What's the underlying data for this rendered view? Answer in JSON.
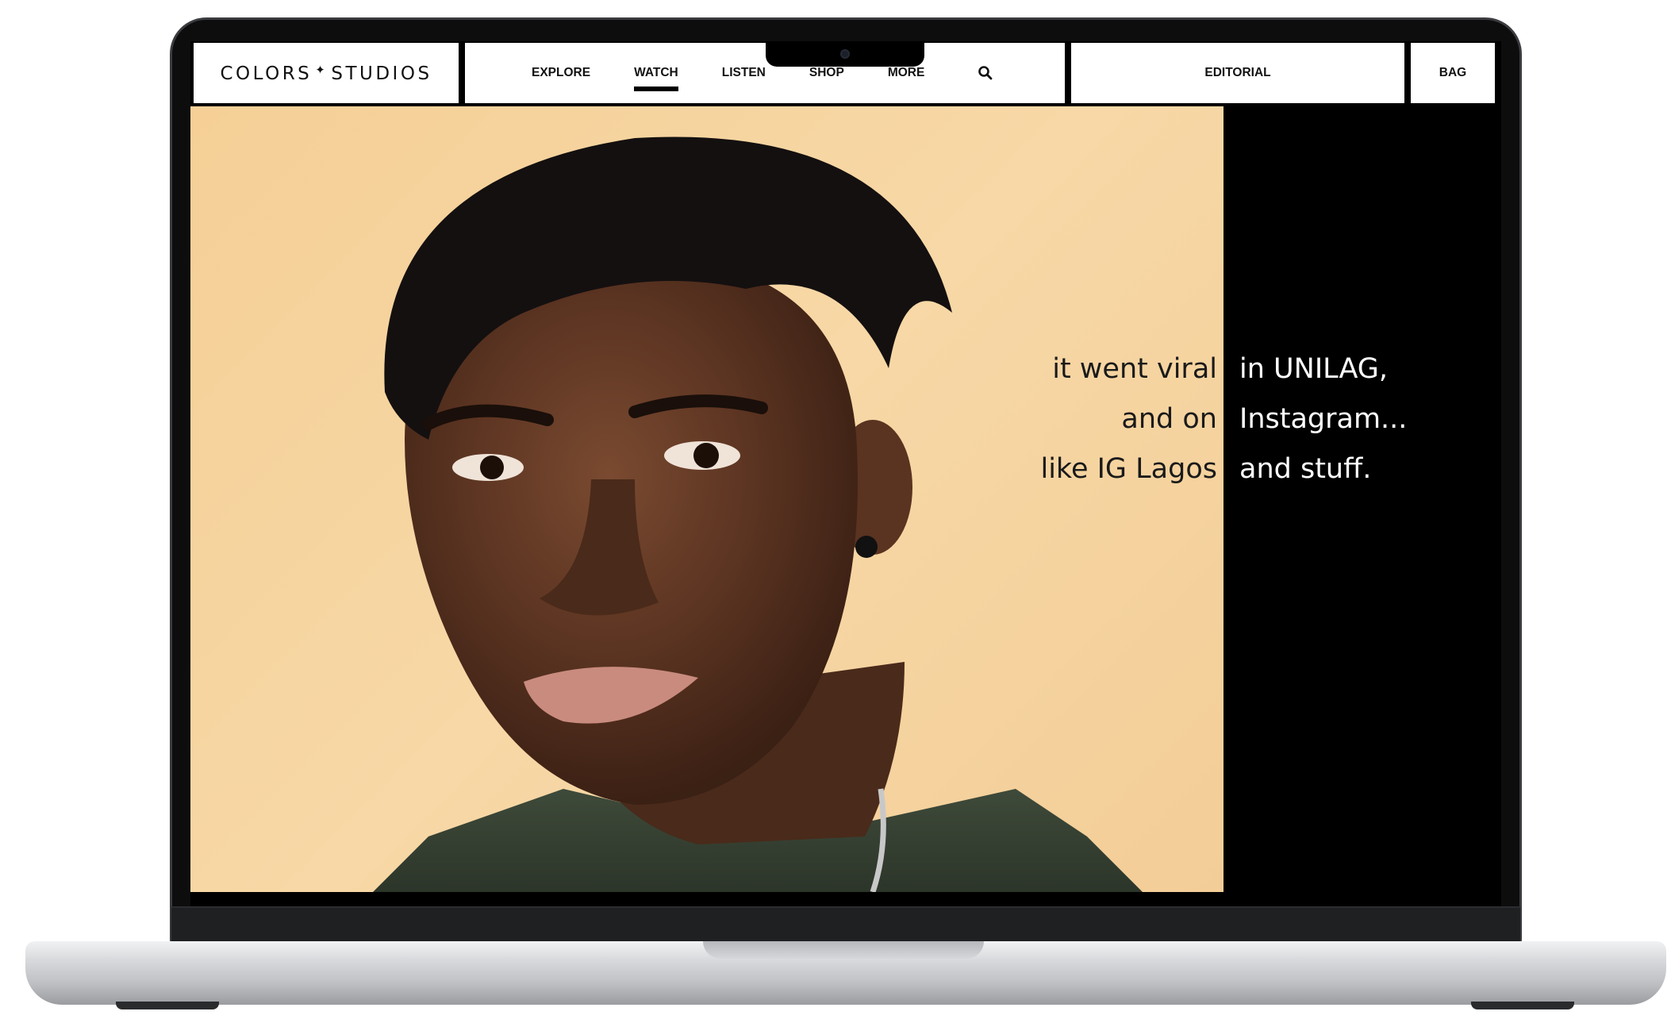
{
  "brand": {
    "logo_left": "COLORS",
    "logo_star": "✦",
    "logo_right": "STUDIOS"
  },
  "nav": {
    "items": [
      {
        "label": "EXPLORE",
        "active": false
      },
      {
        "label": "WATCH",
        "active": true
      },
      {
        "label": "LISTEN",
        "active": false
      },
      {
        "label": "SHOP",
        "active": false
      },
      {
        "label": "MORE",
        "active": false
      }
    ],
    "search_icon": "search-icon",
    "editorial_label": "EDITORIAL",
    "bag_label": "BAG"
  },
  "hero": {
    "image_subject": "portrait-photo",
    "caption_left": [
      "it went viral",
      "and on",
      "like IG Lagos"
    ],
    "caption_right": [
      "in UNILAG,",
      "Instagram...",
      "and stuff."
    ]
  },
  "colors": {
    "hero_background": "#f5cf96",
    "side_panel": "#000000",
    "nav_background": "#ffffff",
    "text_dark": "#1a1a1a",
    "text_light": "#ffffff"
  }
}
